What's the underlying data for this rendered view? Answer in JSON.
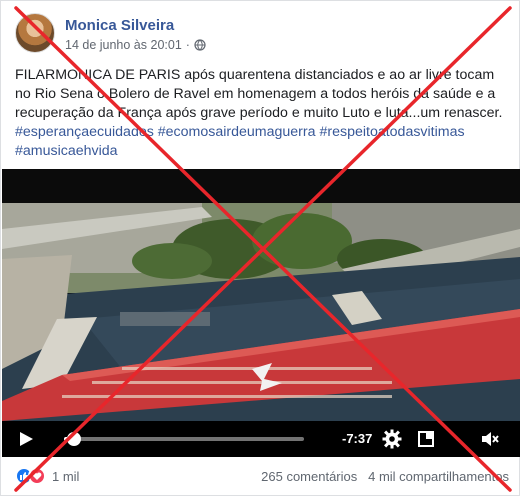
{
  "post": {
    "author": "Monica Silveira",
    "timestamp": "14 de junho às 20:01",
    "privacy_icon": "globe-icon",
    "text": "FILARMONICA DE PARIS após quarentena distanciados e ao ar livre tocam no Rio Sena o Bolero de Ravel em homenagem a todos heróis da saúde e a recuperação da França após grave período e muito Luto e luta...um renascer.",
    "hashtags": [
      "#esperançaecuidados",
      "#ecomosairdeumaguerra",
      "#respeitoatodasvitimas",
      "#amusicaehvida"
    ]
  },
  "video": {
    "time_remaining": "-7:37",
    "progress": 0.03,
    "icons": [
      "play-icon",
      "settings-icon",
      "fullscreen-icon",
      "volume-muted-icon"
    ]
  },
  "footer": {
    "reaction_icons": [
      "like-icon",
      "love-icon"
    ],
    "reaction_count": "1 mil",
    "comments": "265 comentários",
    "shares": "4 mil compartilhamentos"
  },
  "colors": {
    "author": "#385898",
    "hashtag": "#385898",
    "overlay_x": "#e8262b",
    "like": "#1877f2",
    "love": "#f33e58"
  }
}
